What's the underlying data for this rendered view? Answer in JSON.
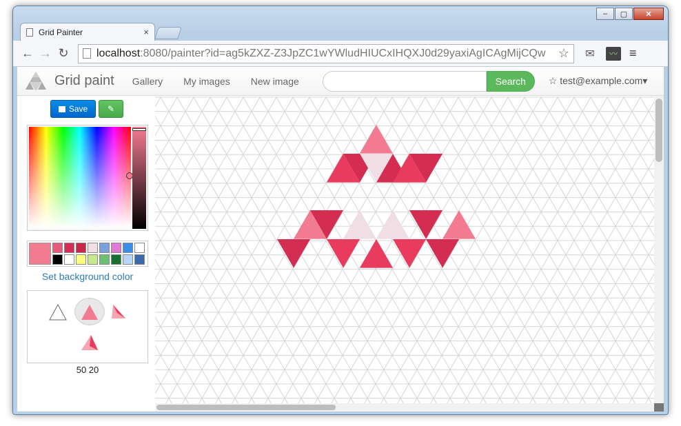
{
  "browser": {
    "tab_title": "Grid Painter",
    "tab_close": "×",
    "url_host": "localhost",
    "url_rest": ":8080/painter?id=ag5kZXZ-Z3JpZC1wYWludHIUCxIHQXJ0d29yaxiAgICAgMijCQw",
    "window_controls": [
      "–",
      "▢",
      "✕"
    ]
  },
  "navbar": {
    "brand": "Grid paint",
    "links": [
      "Gallery",
      "My images",
      "New image"
    ],
    "search_label": "Search",
    "user": "☆ test@example.com▾"
  },
  "sidebar": {
    "save_label": "Save",
    "edit_icon": "✎",
    "bg_link": "Set background color",
    "coords": "50 20",
    "current_color": "#f37b91",
    "swatches_row1": [
      "#e75a7a",
      "#d42d52",
      "#c72749",
      "#f0dfe4",
      "#7aa0e0",
      "#e07ad8",
      "#3a8ee8",
      "#ffffff"
    ],
    "swatches_row2": [
      "#000000",
      "#ffffff",
      "#ffff80",
      "#c8e88e",
      "#6fbf73",
      "#187030",
      "#b8d4f8",
      "#3a6aa8"
    ]
  },
  "canvas": {
    "colors": {
      "light_pink": "#f37b91",
      "crimson": "#d42d52",
      "red": "#e83b5e",
      "pale": "#efdfe4",
      "grid": "#d6d6d6"
    }
  }
}
